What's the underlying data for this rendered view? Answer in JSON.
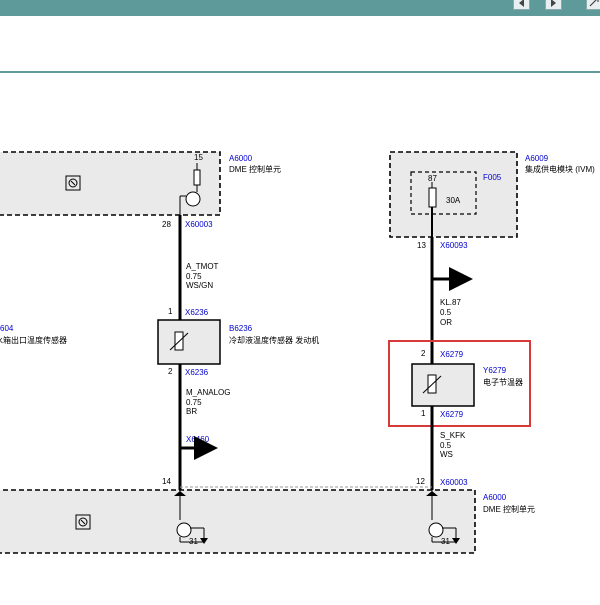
{
  "toolbar": {
    "prev_icon": "arrow-left-icon",
    "next_icon": "arrow-right-icon",
    "expand_icon": "expand-icon"
  },
  "colors": {
    "header": "#5f9a9a",
    "connector_text": "#0000cc",
    "highlight": "#d83a3a"
  },
  "diagram": {
    "dme_top": {
      "id": "A6000",
      "name": "DME 控制单元",
      "pin_top": "15",
      "pin_bottom": "28",
      "connector": "X60003"
    },
    "ivm": {
      "id": "A6009",
      "name": "集成供电模块 (IVM)",
      "fuse_id": "F005",
      "fuse_pin": "87",
      "fuse_rating": "30A",
      "pin": "13",
      "connector": "X60093"
    },
    "wire_tmot": {
      "signal": "A_TMOT",
      "gauge": "0.75",
      "color": "WS/GN"
    },
    "sensor": {
      "id": "B6236",
      "name": "冷却液温度传感器 发动机",
      "connector": "X6236",
      "pin_top": "1",
      "pin_bottom": "2",
      "connector_bottom": "X6236"
    },
    "left_partial": {
      "id_fragment": "604",
      "name_fragment": "水箱出口温度传感器"
    },
    "wire_analog": {
      "signal": "M_ANALOG",
      "gauge": "0.75",
      "color": "BR",
      "connector": "X6460"
    },
    "wire_kl87": {
      "signal": "KL.87",
      "gauge": "0.5",
      "color": "OR"
    },
    "thermostat": {
      "id": "Y6279",
      "name": "电子节温器",
      "connector": "X6279",
      "pin_top": "2",
      "pin_bottom": "1",
      "connector_bottom": "X6279"
    },
    "wire_kfk": {
      "signal": "S_KFK",
      "gauge": "0.5",
      "color": "WS"
    },
    "dme_bottom": {
      "id": "A6000",
      "name": "DME 控制单元",
      "pin_left": "14",
      "pin_right": "12",
      "connector": "X60003",
      "ground_left": "31",
      "ground_right": "31"
    }
  }
}
